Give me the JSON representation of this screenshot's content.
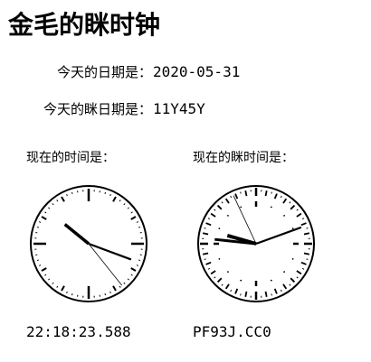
{
  "title": "金毛的眯时钟",
  "date": {
    "label": "今天的日期是：",
    "value": "2020-05-31"
  },
  "mi_date": {
    "label": "今天的眯日期是：",
    "value": "11Y45Y"
  },
  "clock": {
    "caption": "现在的时间是：",
    "digital": "22:18:23.588",
    "hands_deg": {
      "hour": 309.2,
      "minute": 110.4,
      "second": 141.5
    }
  },
  "mi_clock": {
    "caption": "现在的眯时间是：",
    "digital": "PF93J.CC0",
    "hands_deg": {
      "hand1": 276,
      "hand2": 286,
      "hand3": 70,
      "hand4": 335
    }
  }
}
